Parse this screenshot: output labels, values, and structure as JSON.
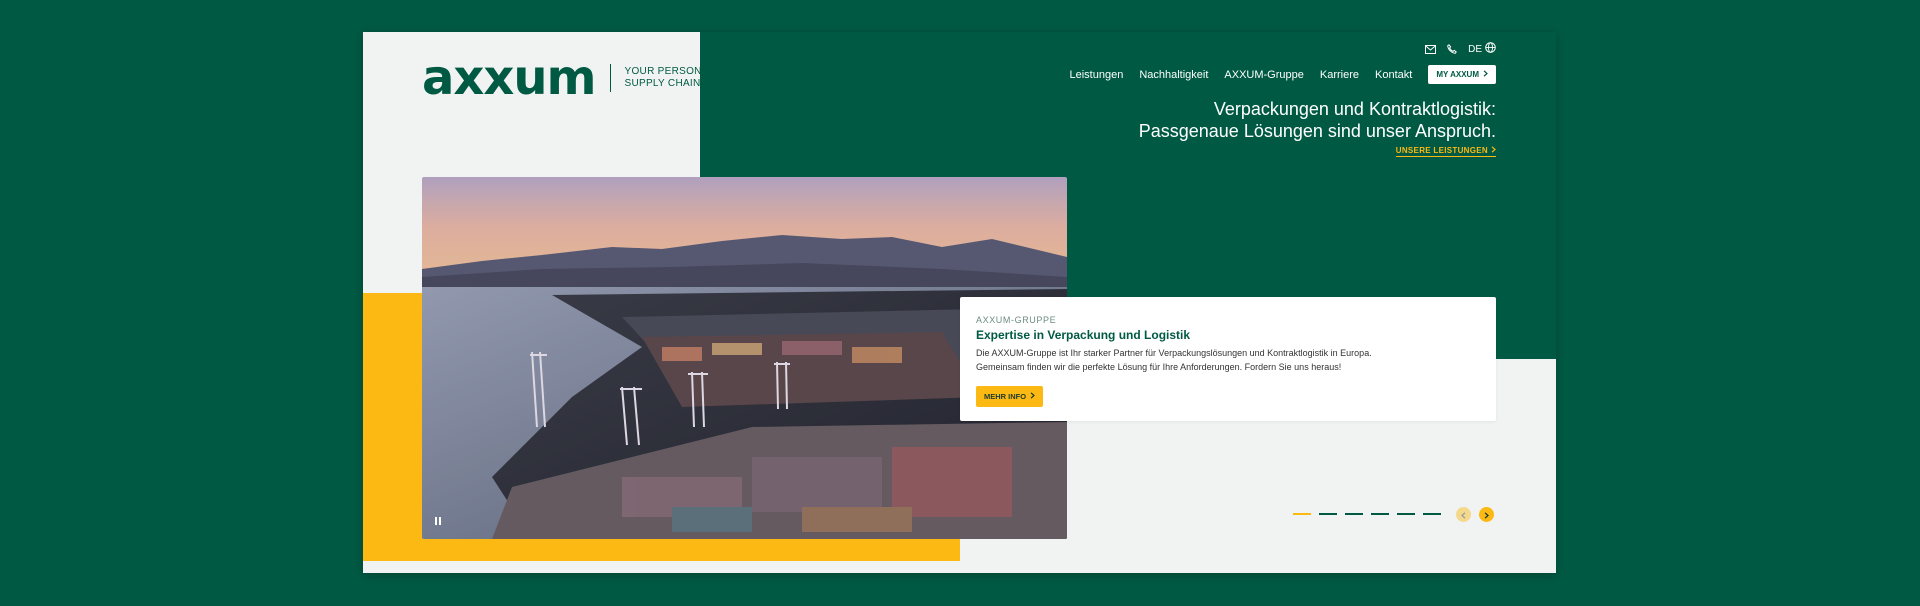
{
  "logo": {
    "wordmark": "axxum",
    "tagline_line1": "YOUR PERSONAL",
    "tagline_line2": "SUPPLY CHAIN"
  },
  "utility": {
    "language": "DE"
  },
  "nav": {
    "items": [
      "Leistungen",
      "Nachhaltigkeit",
      "AXXUM-Gruppe",
      "Karriere",
      "Kontakt"
    ],
    "cta": "MY AXXUM"
  },
  "hero": {
    "title_line1": "Verpackungen und Kontraktlogistik:",
    "title_line2": "Passgenaue Lösungen sind unser Anspruch.",
    "link": "UNSERE LEISTUNGEN"
  },
  "slide": {
    "kicker": "AXXUM-GRUPPE",
    "title": "Expertise in Verpackung und Logistik",
    "text_line1": "Die AXXUM-Gruppe ist Ihr starker Partner für Verpackungslösungen und Kontraktlogistik in Europa.",
    "text_line2": "Gemeinsam finden wir die perfekte Lösung für Ihre Anforderungen. Fordern Sie uns heraus!",
    "button": "MEHR INFO"
  },
  "slider": {
    "count": 6,
    "active_index": 0
  },
  "colors": {
    "brand_green": "#005A43",
    "accent_yellow": "#FDB913",
    "light_gray": "#F1F3F2"
  },
  "icons": [
    "mail-icon",
    "phone-icon",
    "globe-icon",
    "chevron-right-icon",
    "pause-icon",
    "chevron-left-icon"
  ]
}
